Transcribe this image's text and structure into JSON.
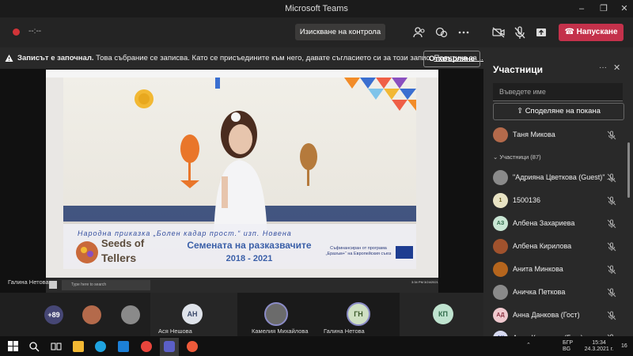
{
  "window": {
    "title": "Microsoft Teams",
    "minimize": "–",
    "restore": "❐",
    "close": "✕"
  },
  "controls": {
    "timer": "--:--",
    "take_back_control": "Изискване на контрола",
    "hang_up": "Напускане"
  },
  "banner": {
    "bold": "Записът е започнал.",
    "text": " Това събрание се записва. Като се присъедините към него, давате съгласието си за този запис. ",
    "link": "Политика за ...",
    "dismiss": "Отхвърляне"
  },
  "shared": {
    "handwriting": "Народна приказка „Болен кадар прост.“ изп. Новена",
    "logo_line1": "Seeds of",
    "logo_line2": "Tellers",
    "title": "Семената на разказвачите",
    "years": "2018 - 2021",
    "eu_text": "Съфинансиран от програма „Еразъм+“ на Европейския съюз",
    "search_placeholder": "Type here to search",
    "clock": "3:34 PM\n3/24/2021",
    "presenter": "Галина Нетова"
  },
  "strip": {
    "overflow": "+89",
    "tiles": [
      {
        "initials": "АН",
        "name": "Ася Нешова",
        "color": "#dfe3ea",
        "textcolor": "#3b4a6b"
      },
      {
        "initials": "",
        "name": "Камелия Михайлова",
        "color": "#6b6b6b",
        "textcolor": "#fff"
      },
      {
        "initials": "ГН",
        "name": "Галина Нетова",
        "color": "#cfe0c3",
        "textcolor": "#3b5a2b"
      },
      {
        "initials": "КП",
        "name": "",
        "color": "#bfe3cf",
        "textcolor": "#2f6a4a"
      }
    ]
  },
  "panel": {
    "title": "Участници",
    "search_placeholder": "Въведете име",
    "share_invite": "Споделяне на покана",
    "presenter": {
      "name": "Таня Микова"
    },
    "section": "Участници (87)",
    "participants": [
      {
        "initials": "",
        "name": "\"Адрияна Цветкова (Guest)\" ...",
        "color": "#8a8a8a",
        "textcolor": "#fff"
      },
      {
        "initials": "1",
        "name": "1500136",
        "color": "#e8e3c4",
        "textcolor": "#6b5f1f"
      },
      {
        "initials": "АЗ",
        "name": "Албена Захариева",
        "color": "#c9e6d4",
        "textcolor": "#2f6a4a"
      },
      {
        "initials": "",
        "name": "Албена Кирилова",
        "color": "#a0522d",
        "textcolor": "#fff"
      },
      {
        "initials": "",
        "name": "Анита Минкова",
        "color": "#b5651d",
        "textcolor": "#fff"
      },
      {
        "initials": "",
        "name": "Аничка Петкова",
        "color": "#8a8a8a",
        "textcolor": "#fff"
      },
      {
        "initials": "АД",
        "name": "Анна Данкова (Гост)",
        "color": "#f0c9cf",
        "textcolor": "#8a2f3f"
      },
      {
        "initials": "АК",
        "name": "Анна Кръстева (Гост)",
        "color": "#d6d9f0",
        "textcolor": "#3b4a8a"
      }
    ]
  },
  "taskbar": {
    "lang1": "БГР",
    "lang2": "BG",
    "time": "15:34",
    "date": "24.3.2021 г.",
    "notifications": "16"
  }
}
